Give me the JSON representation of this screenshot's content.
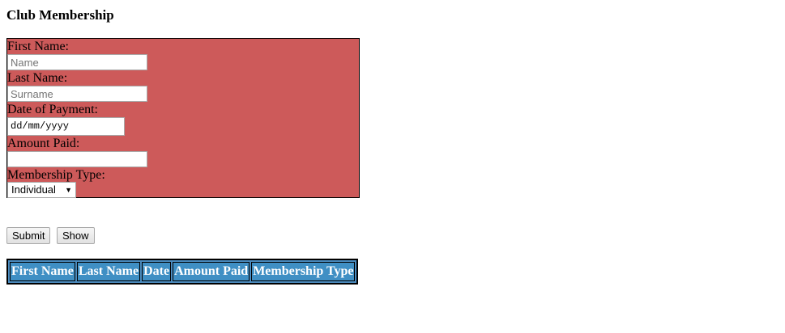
{
  "page": {
    "title": "Club Membership"
  },
  "form": {
    "first_name": {
      "label": "First Name:",
      "placeholder": "Name",
      "value": ""
    },
    "last_name": {
      "label": "Last Name:",
      "placeholder": "Surname",
      "value": ""
    },
    "date_of_payment": {
      "label": "Date of Payment:",
      "value": "dd/mm/yyyy"
    },
    "amount_paid": {
      "label": "Amount Paid:",
      "value": ""
    },
    "membership_type": {
      "label": "Membership Type:",
      "selected": "Individual"
    }
  },
  "buttons": {
    "submit_label": "Submit",
    "show_label": "Show"
  },
  "table": {
    "headers": [
      "First Name",
      "Last Name",
      "Date",
      "Amount Paid",
      "Membership Type"
    ],
    "rows": []
  },
  "colors": {
    "form_background": "#cd5a5a",
    "table_header_background": "#3f8fc4"
  }
}
